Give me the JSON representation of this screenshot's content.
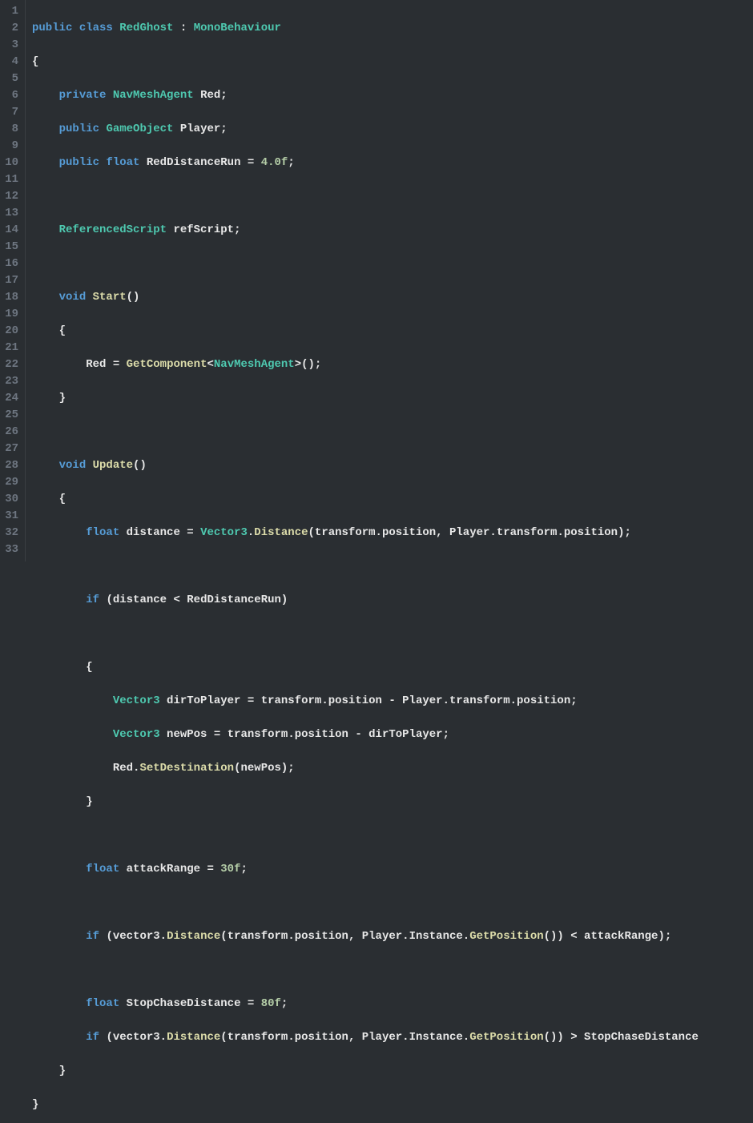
{
  "editor": {
    "language": "csharp",
    "lineCount": 33,
    "tokens": {
      "public": "public",
      "class": "class",
      "private": "private",
      "void": "void",
      "float": "float",
      "if": "if",
      "RedGhost": "RedGhost",
      "MonoBehaviour": "MonoBehaviour",
      "NavMeshAgent": "NavMeshAgent",
      "Red": "Red",
      "GameObject": "GameObject",
      "Player": "Player",
      "RedDistanceRun": "RedDistanceRun",
      "fourF": "4.0f",
      "ReferencedScript": "ReferencedScript",
      "refScript": "refScript",
      "Start": "Start",
      "GetComponent": "GetComponent",
      "Update": "Update",
      "distance": "distance",
      "Vector3": "Vector3",
      "Distance": "Distance",
      "transform": "transform",
      "position": "position",
      "dirToPlayer": "dirToPlayer",
      "newPos": "newPos",
      "SetDestination": "SetDestination",
      "attackRange": "attackRange",
      "thirtyF": "30f",
      "vector3": "vector3",
      "Instance": "Instance",
      "GetPosition": "GetPosition",
      "StopChaseDistance": "StopChaseDistance",
      "eightyF": "80f"
    }
  }
}
